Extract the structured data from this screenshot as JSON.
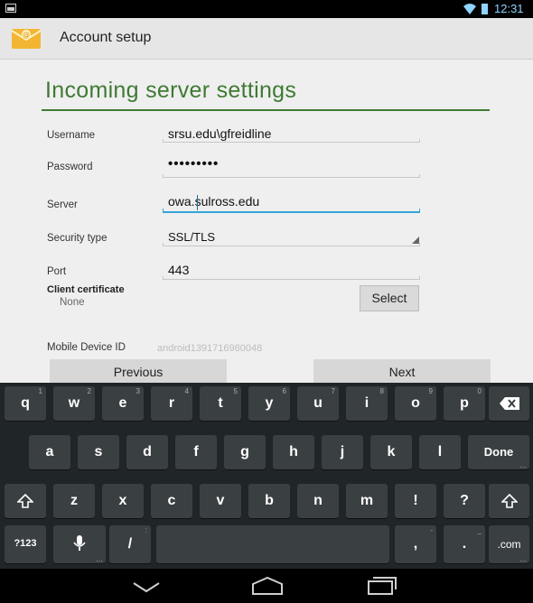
{
  "status_bar": {
    "time": "12:31"
  },
  "action_bar": {
    "title": "Account setup"
  },
  "screen": {
    "heading": "Incoming server settings"
  },
  "form": {
    "username": {
      "label": "Username",
      "value": "srsu.edu\\gfreidline"
    },
    "password": {
      "label": "Password",
      "value": "•••••••••"
    },
    "server": {
      "label": "Server",
      "value": "owa.sulross.edu"
    },
    "security_type": {
      "label": "Security type",
      "value": "SSL/TLS"
    },
    "port": {
      "label": "Port",
      "value": "443"
    },
    "client_certificate": {
      "label": "Client certificate",
      "value": "None",
      "button": "Select"
    },
    "mobile_device_id": {
      "label": "Mobile Device ID",
      "value": "android1391716980048"
    }
  },
  "nav": {
    "previous": "Previous",
    "next": "Next"
  },
  "keyboard": {
    "row1": [
      {
        "k": "q",
        "h": "1"
      },
      {
        "k": "w",
        "h": "2"
      },
      {
        "k": "e",
        "h": "3"
      },
      {
        "k": "r",
        "h": "4"
      },
      {
        "k": "t",
        "h": "5"
      },
      {
        "k": "y",
        "h": "6"
      },
      {
        "k": "u",
        "h": "7"
      },
      {
        "k": "i",
        "h": "8"
      },
      {
        "k": "o",
        "h": "9"
      },
      {
        "k": "p",
        "h": "0"
      }
    ],
    "row2": [
      "a",
      "s",
      "d",
      "f",
      "g",
      "h",
      "j",
      "k",
      "l"
    ],
    "row3": [
      "z",
      "x",
      "c",
      "v",
      "b",
      "n",
      "m",
      "!",
      "?"
    ],
    "done": "Done",
    "sym": "?123",
    "slash": "/",
    "comma": ",",
    "period": ".",
    "com": ".com"
  }
}
